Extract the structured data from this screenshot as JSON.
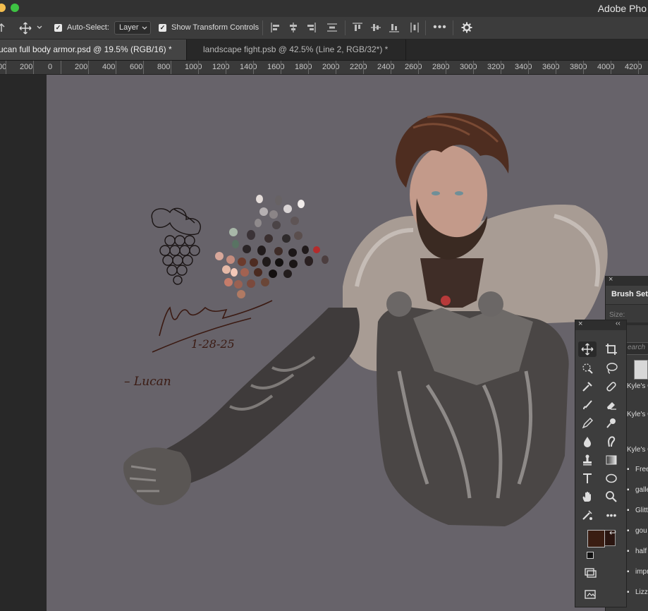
{
  "app": {
    "title": "Adobe Pho"
  },
  "options_bar": {
    "auto_select_label": "Auto-Select:",
    "auto_select_checked": true,
    "layer_select_value": "Layer",
    "show_transform_label": "Show Transform Controls",
    "show_transform_checked": true
  },
  "tabs": [
    {
      "label": "ucan full body armor.psd @ 19.5% (RGB/16) *",
      "active": true
    },
    {
      "label": "landscape fight.psb @ 42.5% (Line 2, RGB/32*) *",
      "active": false
    }
  ],
  "ruler": {
    "labels": [
      "00",
      "200",
      "0",
      "200",
      "400",
      "600",
      "800",
      "1000",
      "1200",
      "1400",
      "1600",
      "1800",
      "2000",
      "2200",
      "2400",
      "2600",
      "2800",
      "3000",
      "3200",
      "3400",
      "3600",
      "3800",
      "4000",
      "4200"
    ]
  },
  "canvas": {
    "signature_date": "1-28-25",
    "name_note": "– Lucan"
  },
  "brush_panel": {
    "title": "Brush Sett",
    "size_label": "Size:",
    "search_placeholder": "earch",
    "layers": [
      "Kyle's C",
      "Kyle's C",
      "Kyle's C",
      "Free",
      "galle",
      "Glitt",
      "gou",
      "half",
      "impr",
      "Lizz"
    ]
  },
  "colors": {
    "foreground": "#3a1d12",
    "background": "#2a1510",
    "canvas": "#67636a",
    "accent_tab": "#444444"
  }
}
